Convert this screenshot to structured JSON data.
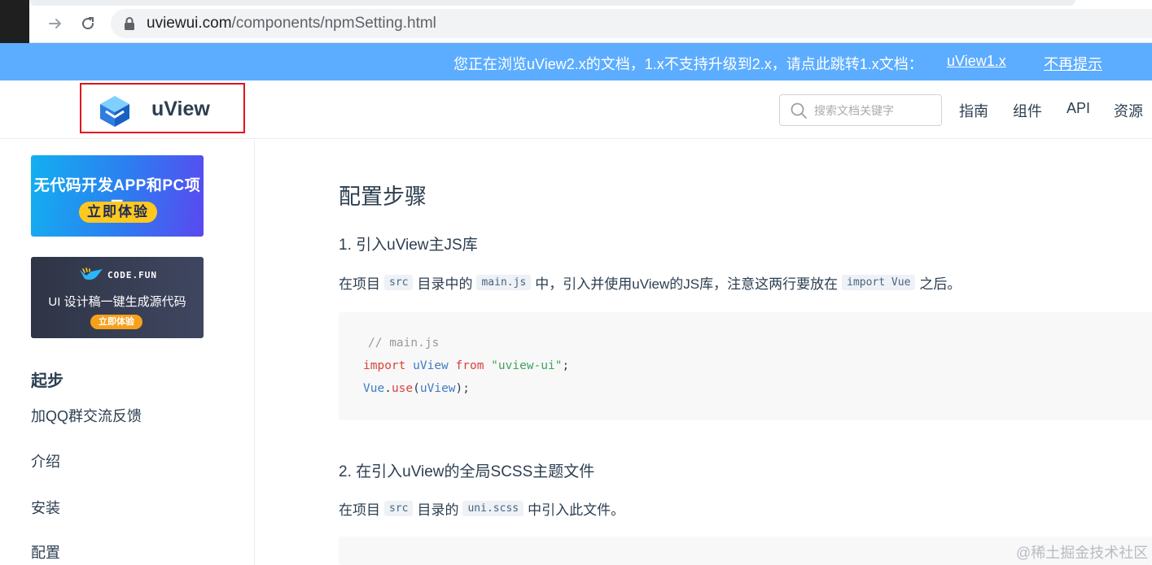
{
  "browser": {
    "url_host": "uviewui.com",
    "url_path": "/components/npmSetting.html",
    "icons": [
      "forward-icon",
      "reload-icon",
      "lock-icon"
    ]
  },
  "notice": {
    "text": "您正在浏览uView2.x的文档，1.x不支持升级到2.x，请点此跳转1.x文档：",
    "link_label": "uView1.x",
    "dismiss_label": "不再提示"
  },
  "header": {
    "logo_text": "uView",
    "search_placeholder": "搜索文档关键字",
    "nav": [
      "指南",
      "组件",
      "API",
      "资源"
    ]
  },
  "sidebar": {
    "ad1": {
      "title": "无代码开发APP和PC项目",
      "button": "立即体验"
    },
    "ad2": {
      "brand": "CODE.FUN",
      "title": "UI 设计稿一键生成源代码",
      "button": "立即体验"
    },
    "group_title": "起步",
    "items": [
      "加QQ群交流反馈",
      "介绍",
      "安装",
      "配置"
    ]
  },
  "content": {
    "title": "配置步骤",
    "step1": {
      "heading": "1. 引入uView主JS库",
      "p_a": "在项目",
      "code_a": "src",
      "p_b": "目录中的",
      "code_b": "main.js",
      "p_c": "中，引入并使用uView的JS库，注意这两行要放在",
      "code_c": "import Vue",
      "p_d": "之后。",
      "code": {
        "comment": "// main.js",
        "kw_import": "import",
        "ident_uview": "uView",
        "kw_from": "from",
        "str_module": "\"uview-ui\"",
        "semicolon": ";",
        "vue": "Vue",
        "dot": ".",
        "use": "use",
        "paren_open": "(",
        "arg": "uView",
        "paren_close": ");"
      }
    },
    "step2": {
      "heading": "2. 在引入uView的全局SCSS主题文件",
      "p_a": "在项目",
      "code_a": "src",
      "p_b": "目录的",
      "code_b": "uni.scss",
      "p_c": "中引入此文件。"
    }
  },
  "watermark": "@稀土掘金技术社区",
  "colors": {
    "notice_bg": "#5cadff",
    "highlight_border": "#e0141e",
    "text": "#2c3e50"
  }
}
